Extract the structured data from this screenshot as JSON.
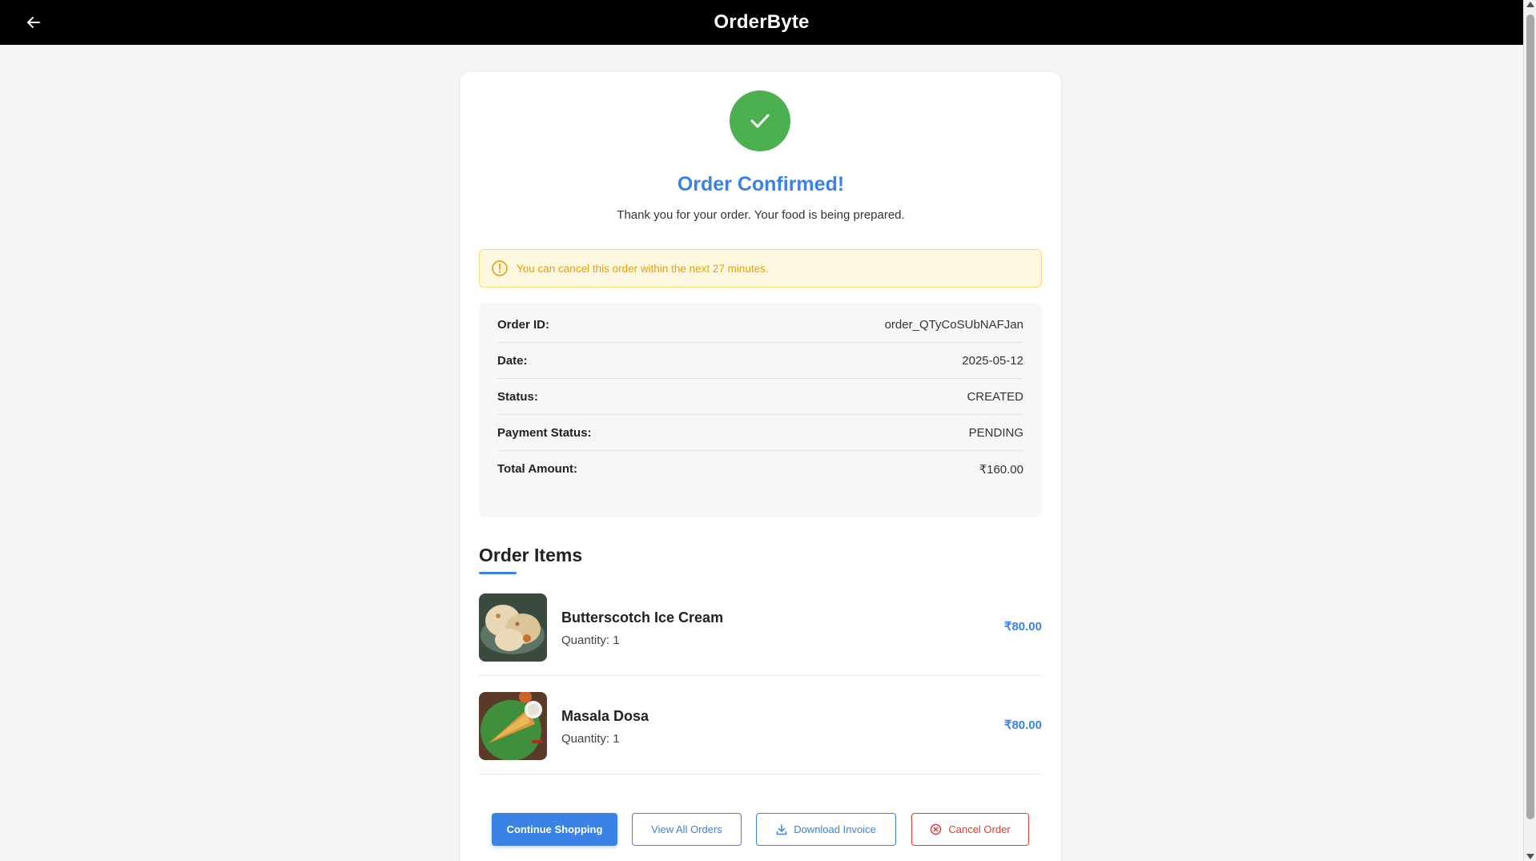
{
  "header": {
    "brand": "OrderByte",
    "back_icon": "arrow-left-icon"
  },
  "confirmation": {
    "icon": "check-icon",
    "title": "Order Confirmed!",
    "message": "Thank you for your order. Your food is being prepared."
  },
  "alert": {
    "icon": "info-circle-icon",
    "text": "You can cancel this order within the next 27 minutes."
  },
  "details": [
    {
      "label": "Order ID:",
      "value": "order_QTyCoSUbNAFJan"
    },
    {
      "label": "Date:",
      "value": "2025-05-12"
    },
    {
      "label": "Status:",
      "value": "CREATED"
    },
    {
      "label": "Payment Status:",
      "value": "PENDING"
    },
    {
      "label": "Total Amount:",
      "value": "₹160.00"
    }
  ],
  "items_section": {
    "heading": "Order Items",
    "items": [
      {
        "name": "Butterscotch Ice Cream",
        "quantity": "Quantity: 1",
        "price": "₹80.00"
      },
      {
        "name": "Masala Dosa",
        "quantity": "Quantity: 1",
        "price": "₹80.00"
      }
    ]
  },
  "actions": {
    "continue_shopping": "Continue Shopping",
    "view_all_orders": "View All Orders",
    "download_invoice": "Download Invoice",
    "cancel_order": "Cancel Order"
  },
  "colors": {
    "accent": "#3a82e6",
    "success": "#4caf50",
    "warning": "#e6a100",
    "danger": "#e53935"
  }
}
